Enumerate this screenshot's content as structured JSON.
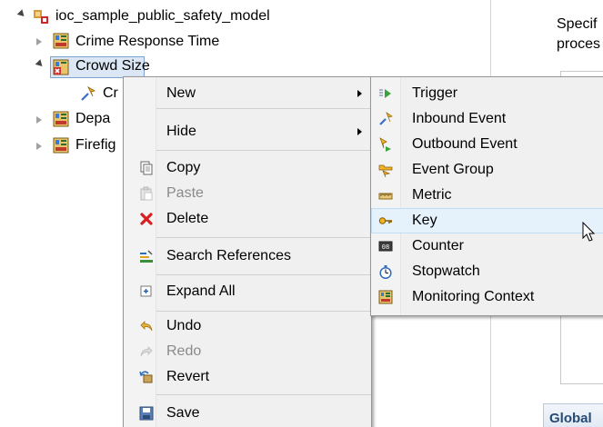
{
  "tree": {
    "root": "ioc_sample_public_safety_model",
    "items": [
      {
        "label": "Crime Response Time"
      },
      {
        "label": "Crowd Size"
      },
      {
        "label": "Cr"
      },
      {
        "label": "Depa"
      },
      {
        "label": "Firefig"
      }
    ]
  },
  "right_panel": {
    "line1": "Specif",
    "line2": "proces",
    "footer": "Global"
  },
  "context_menu": {
    "items": [
      {
        "label": "New",
        "icon": "none",
        "submenu": true
      },
      {
        "label": "Hide",
        "icon": "none",
        "submenu": true
      },
      {
        "label": "Copy",
        "icon": "copy-icon"
      },
      {
        "label": "Paste",
        "icon": "paste-icon",
        "disabled": true
      },
      {
        "label": "Delete",
        "icon": "delete-icon"
      },
      {
        "label": "Search References",
        "icon": "search-references-icon"
      },
      {
        "label": "Expand All",
        "icon": "expand-all-icon"
      },
      {
        "label": "Undo",
        "icon": "undo-icon"
      },
      {
        "label": "Redo",
        "icon": "redo-icon",
        "disabled": true
      },
      {
        "label": "Revert",
        "icon": "revert-icon"
      },
      {
        "label": "Save",
        "icon": "save-icon"
      }
    ]
  },
  "submenu": {
    "items": [
      {
        "label": "Trigger",
        "icon": "trigger-icon"
      },
      {
        "label": "Inbound Event",
        "icon": "inbound-event-icon"
      },
      {
        "label": "Outbound Event",
        "icon": "outbound-event-icon"
      },
      {
        "label": "Event Group",
        "icon": "event-group-icon"
      },
      {
        "label": "Metric",
        "icon": "metric-icon"
      },
      {
        "label": "Key",
        "icon": "key-icon",
        "highlighted": true
      },
      {
        "label": "Counter",
        "icon": "counter-icon"
      },
      {
        "label": "Stopwatch",
        "icon": "stopwatch-icon"
      },
      {
        "label": "Monitoring Context",
        "icon": "monitoring-context-icon"
      }
    ]
  },
  "colors": {
    "menu_bg": "#f0f0f0",
    "highlight": "#e5f1fb",
    "tree_selection_border": "#7da2ce"
  }
}
